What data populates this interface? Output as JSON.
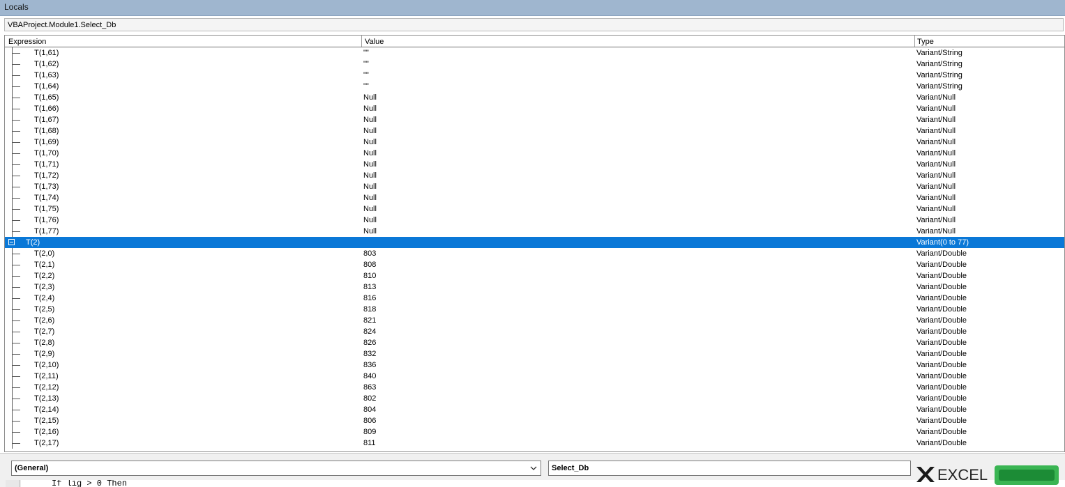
{
  "window": {
    "title": "Locals"
  },
  "context": {
    "procedure": "VBAProject.Module1.Select_Db"
  },
  "columns": {
    "expression": "Expression",
    "value": "Value",
    "type": "Type"
  },
  "rows_before": [
    {
      "expr": "T(1,61)",
      "value": "\"\"",
      "type": "Variant/String"
    },
    {
      "expr": "T(1,62)",
      "value": "\"\"",
      "type": "Variant/String"
    },
    {
      "expr": "T(1,63)",
      "value": "\"\"",
      "type": "Variant/String"
    },
    {
      "expr": "T(1,64)",
      "value": "\"\"",
      "type": "Variant/String"
    },
    {
      "expr": "T(1,65)",
      "value": "Null",
      "type": "Variant/Null"
    },
    {
      "expr": "T(1,66)",
      "value": "Null",
      "type": "Variant/Null"
    },
    {
      "expr": "T(1,67)",
      "value": "Null",
      "type": "Variant/Null"
    },
    {
      "expr": "T(1,68)",
      "value": "Null",
      "type": "Variant/Null"
    },
    {
      "expr": "T(1,69)",
      "value": "Null",
      "type": "Variant/Null"
    },
    {
      "expr": "T(1,70)",
      "value": "Null",
      "type": "Variant/Null"
    },
    {
      "expr": "T(1,71)",
      "value": "Null",
      "type": "Variant/Null"
    },
    {
      "expr": "T(1,72)",
      "value": "Null",
      "type": "Variant/Null"
    },
    {
      "expr": "T(1,73)",
      "value": "Null",
      "type": "Variant/Null"
    },
    {
      "expr": "T(1,74)",
      "value": "Null",
      "type": "Variant/Null"
    },
    {
      "expr": "T(1,75)",
      "value": "Null",
      "type": "Variant/Null"
    },
    {
      "expr": "T(1,76)",
      "value": "Null",
      "type": "Variant/Null"
    },
    {
      "expr": "T(1,77)",
      "value": "Null",
      "type": "Variant/Null"
    }
  ],
  "selected_row": {
    "expr": "T(2)",
    "value": "",
    "type": "Variant(0 to 77)"
  },
  "rows_after": [
    {
      "expr": "T(2,0)",
      "value": "803",
      "type": "Variant/Double"
    },
    {
      "expr": "T(2,1)",
      "value": "808",
      "type": "Variant/Double"
    },
    {
      "expr": "T(2,2)",
      "value": "810",
      "type": "Variant/Double"
    },
    {
      "expr": "T(2,3)",
      "value": "813",
      "type": "Variant/Double"
    },
    {
      "expr": "T(2,4)",
      "value": "816",
      "type": "Variant/Double"
    },
    {
      "expr": "T(2,5)",
      "value": "818",
      "type": "Variant/Double"
    },
    {
      "expr": "T(2,6)",
      "value": "821",
      "type": "Variant/Double"
    },
    {
      "expr": "T(2,7)",
      "value": "824",
      "type": "Variant/Double"
    },
    {
      "expr": "T(2,8)",
      "value": "826",
      "type": "Variant/Double"
    },
    {
      "expr": "T(2,9)",
      "value": "832",
      "type": "Variant/Double"
    },
    {
      "expr": "T(2,10)",
      "value": "836",
      "type": "Variant/Double"
    },
    {
      "expr": "T(2,11)",
      "value": "840",
      "type": "Variant/Double"
    },
    {
      "expr": "T(2,12)",
      "value": "863",
      "type": "Variant/Double"
    },
    {
      "expr": "T(2,13)",
      "value": "802",
      "type": "Variant/Double"
    },
    {
      "expr": "T(2,14)",
      "value": "804",
      "type": "Variant/Double"
    },
    {
      "expr": "T(2,15)",
      "value": "806",
      "type": "Variant/Double"
    },
    {
      "expr": "T(2,16)",
      "value": "809",
      "type": "Variant/Double"
    },
    {
      "expr": "T(2,17)",
      "value": "811",
      "type": "Variant/Double"
    }
  ],
  "code_window": {
    "object_combo": "(General)",
    "procedure_combo": "Select_Db",
    "code_line": "If lig > 0 Then"
  },
  "watermark": {
    "text": "EXCEL"
  },
  "colors": {
    "selection": "#0a78d7",
    "titlebar": "#9fb6cf"
  }
}
